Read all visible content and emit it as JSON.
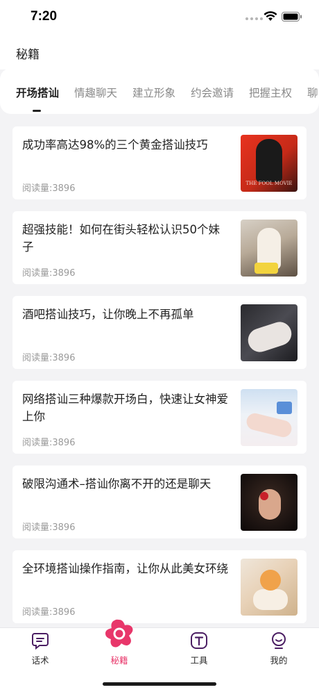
{
  "status_bar": {
    "time": "7:20"
  },
  "header": {
    "title": "秘籍"
  },
  "tabs": [
    {
      "label": "开场搭讪",
      "active": true
    },
    {
      "label": "情趣聊天",
      "active": false
    },
    {
      "label": "建立形象",
      "active": false
    },
    {
      "label": "约会邀请",
      "active": false
    },
    {
      "label": "把握主权",
      "active": false
    },
    {
      "label": "聊",
      "active": false
    }
  ],
  "articles": [
    {
      "title": "成功率高达98%的三个黄金搭讪技巧",
      "reads": "阅读量:3896",
      "thumb_caption": "THE FOOL MOVIE"
    },
    {
      "title": "超强技能！如何在街头轻松认识50个妹子",
      "reads": "阅读量:3896"
    },
    {
      "title": "酒吧搭讪技巧，让你晚上不再孤单",
      "reads": "阅读量:3896"
    },
    {
      "title": "网络搭讪三种爆款开场白，快速让女神爱上你",
      "reads": "阅读量:3896"
    },
    {
      "title": "破限沟通术–搭讪你离不开的还是聊天",
      "reads": "阅读量:3896"
    },
    {
      "title": "全环境搭讪操作指南，让你从此美女环绕",
      "reads": "阅读量:3896"
    }
  ],
  "tabbar": [
    {
      "label": "话术",
      "icon": "chat-bubble-icon",
      "active": false
    },
    {
      "label": "秘籍",
      "icon": "flower-icon",
      "active": true
    },
    {
      "label": "工具",
      "icon": "tool-t-icon",
      "active": false
    },
    {
      "label": "我的",
      "icon": "profile-icon",
      "active": false
    }
  ],
  "colors": {
    "accent": "#e8366a",
    "icon_purple": "#4b1e63",
    "background": "#f3f3f5"
  }
}
